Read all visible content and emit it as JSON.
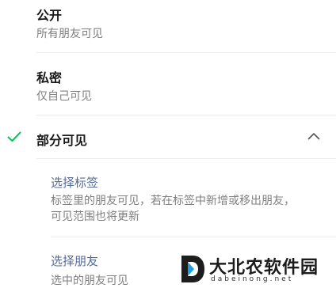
{
  "options": {
    "public": {
      "title": "公开",
      "desc": "所有朋友可见"
    },
    "private": {
      "title": "私密",
      "desc": "仅自己可见"
    },
    "partial": {
      "title": "部分可见",
      "selected": true,
      "sub": {
        "select_tags": {
          "title": "选择标签",
          "desc": "标签里的朋友可见，若在标签中新增或移出朋友，可见范围也将更新"
        },
        "select_friends": {
          "title": "选择朋友",
          "desc": "选中的朋友可见"
        }
      }
    }
  },
  "icons": {
    "selected": "check-icon",
    "expand": "chevron-up-icon"
  },
  "colors": {
    "check": "#07c160",
    "link": "#576b95",
    "secondary_text": "#7f7f7f",
    "divider": "#ececec"
  },
  "watermark": {
    "name": "大北农软件园",
    "url": "dabeinong.net"
  }
}
